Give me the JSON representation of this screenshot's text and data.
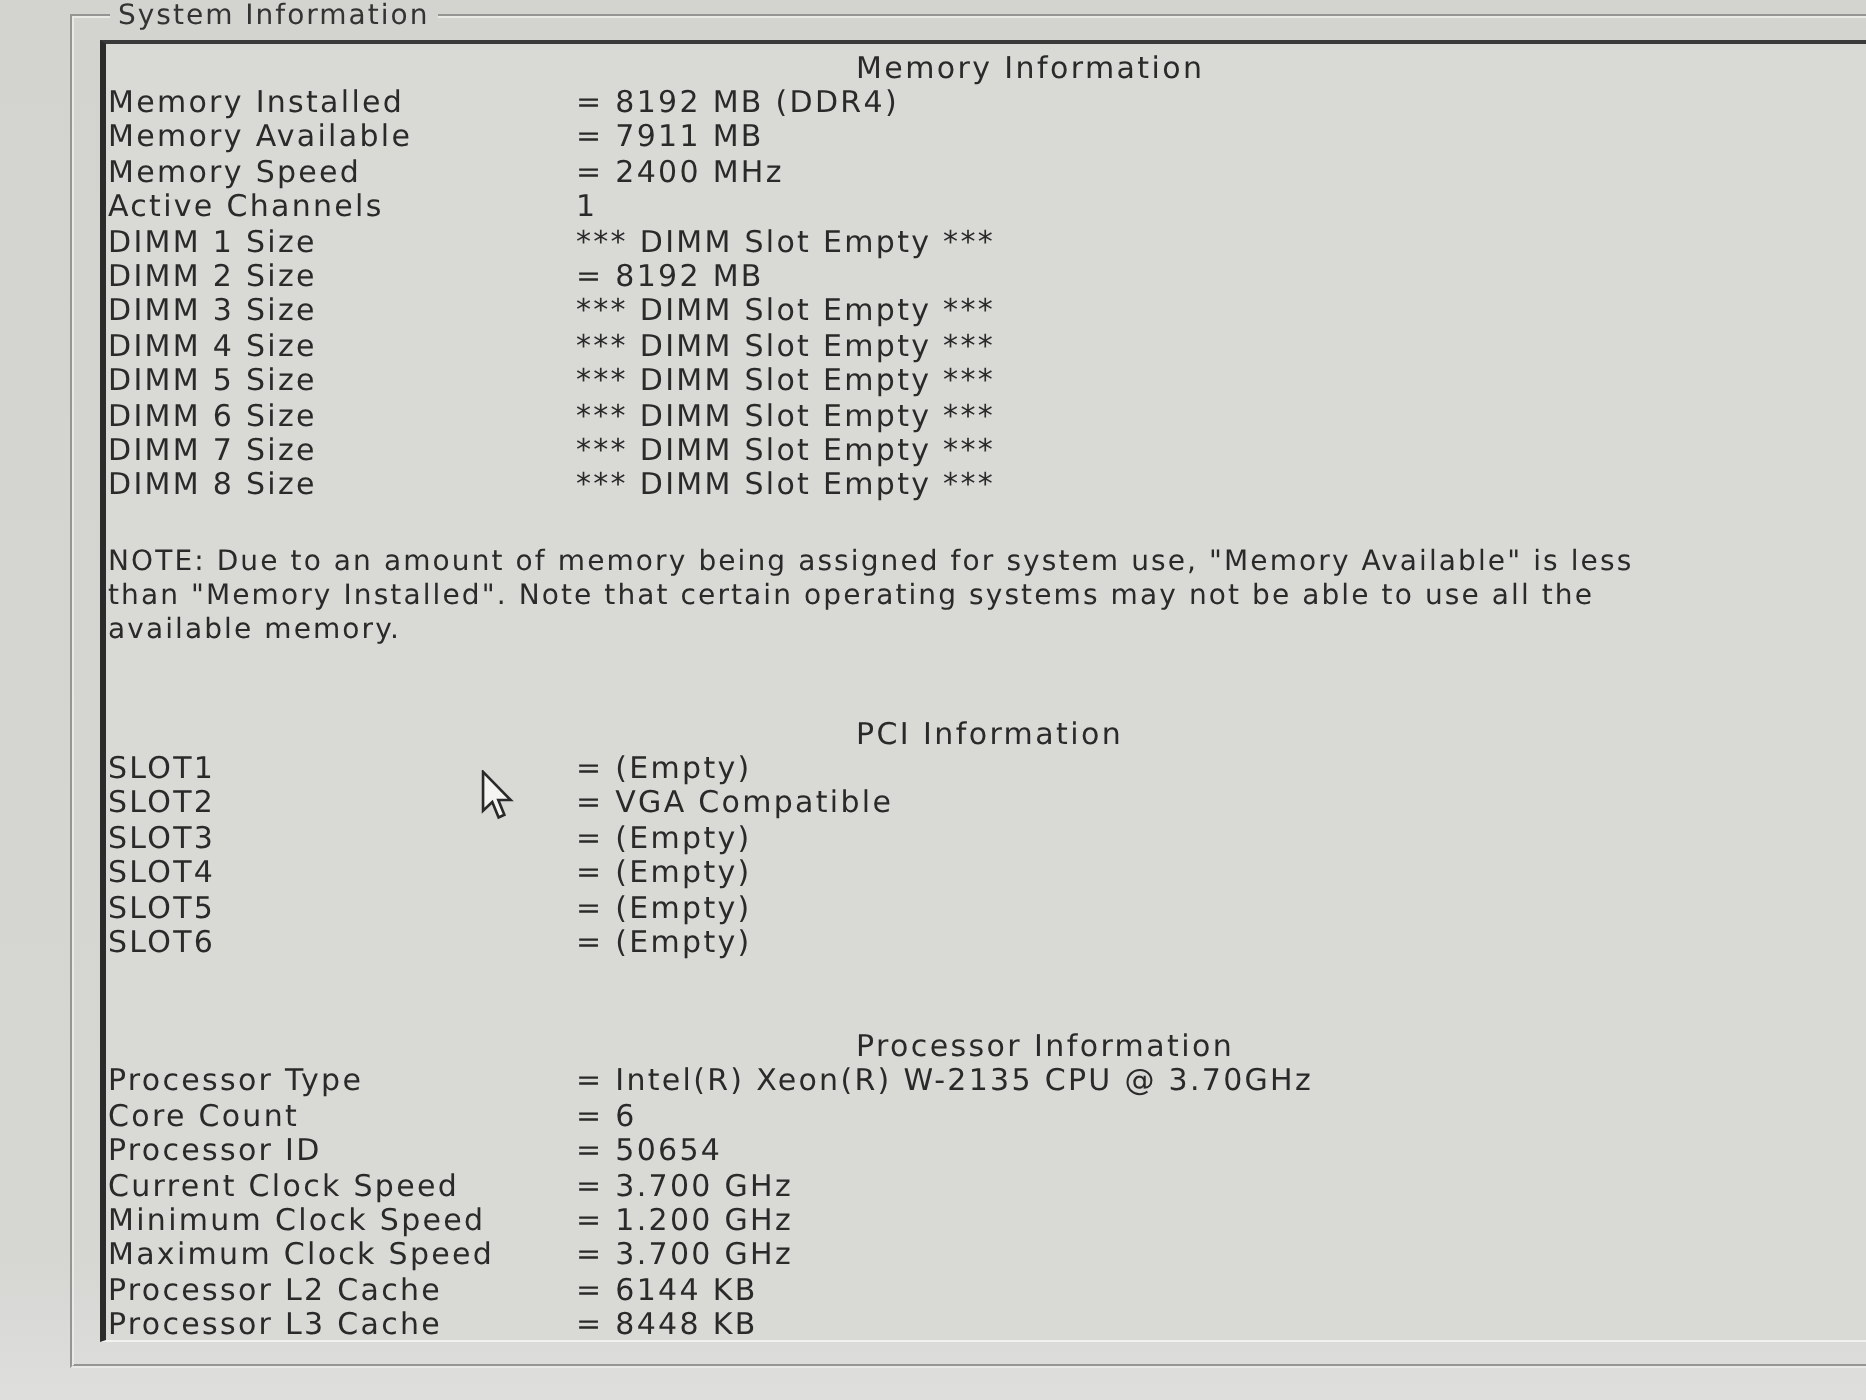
{
  "group_title": "System Information",
  "sections": [
    {
      "kind": "table",
      "title": "Memory Information",
      "rows": [
        {
          "label": "Memory Installed",
          "value": "= 8192 MB (DDR4)"
        },
        {
          "label": "Memory Available",
          "value": "= 7911 MB"
        },
        {
          "label": "Memory Speed",
          "value": "= 2400 MHz"
        },
        {
          "label": "Active Channels",
          "value": "1"
        },
        {
          "label": "DIMM 1 Size",
          "value": "*** DIMM Slot Empty ***"
        },
        {
          "label": "DIMM 2 Size",
          "value": "= 8192 MB"
        },
        {
          "label": "DIMM 3 Size",
          "value": "*** DIMM Slot Empty ***"
        },
        {
          "label": "DIMM 4 Size",
          "value": "*** DIMM Slot Empty ***"
        },
        {
          "label": "DIMM 5 Size",
          "value": "*** DIMM Slot Empty ***"
        },
        {
          "label": "DIMM 6 Size",
          "value": "*** DIMM Slot Empty ***"
        },
        {
          "label": "DIMM 7 Size",
          "value": "*** DIMM Slot Empty ***"
        },
        {
          "label": "DIMM 8 Size",
          "value": "*** DIMM Slot Empty ***"
        }
      ]
    },
    {
      "kind": "note",
      "text": "NOTE: Due to an amount of memory being assigned for system use, \"Memory Available\" is less than \"Memory Installed\". Note that certain operating systems may not be able to use all the available memory."
    },
    {
      "kind": "table",
      "title": "PCI Information",
      "rows": [
        {
          "label": "SLOT1",
          "value": "= (Empty)"
        },
        {
          "label": "SLOT2",
          "value": "= VGA Compatible"
        },
        {
          "label": "SLOT3",
          "value": "= (Empty)"
        },
        {
          "label": "SLOT4",
          "value": "= (Empty)"
        },
        {
          "label": "SLOT5",
          "value": "= (Empty)"
        },
        {
          "label": "SLOT6",
          "value": "= (Empty)"
        }
      ]
    },
    {
      "kind": "table",
      "title": "Processor Information",
      "rows": [
        {
          "label": "Processor Type",
          "value": "= Intel(R) Xeon(R) W-2135 CPU @ 3.70GHz"
        },
        {
          "label": "Core Count",
          "value": "= 6"
        },
        {
          "label": "Processor ID",
          "value": "= 50654"
        },
        {
          "label": "Current Clock Speed",
          "value": "= 3.700 GHz"
        },
        {
          "label": "Minimum Clock Speed",
          "value": "= 1.200 GHz"
        },
        {
          "label": "Maximum Clock Speed",
          "value": "= 3.700 GHz"
        },
        {
          "label": "Processor L2 Cache",
          "value": "= 6144 KB"
        },
        {
          "label": "Processor L3 Cache",
          "value": "= 8448 KB"
        }
      ]
    }
  ]
}
